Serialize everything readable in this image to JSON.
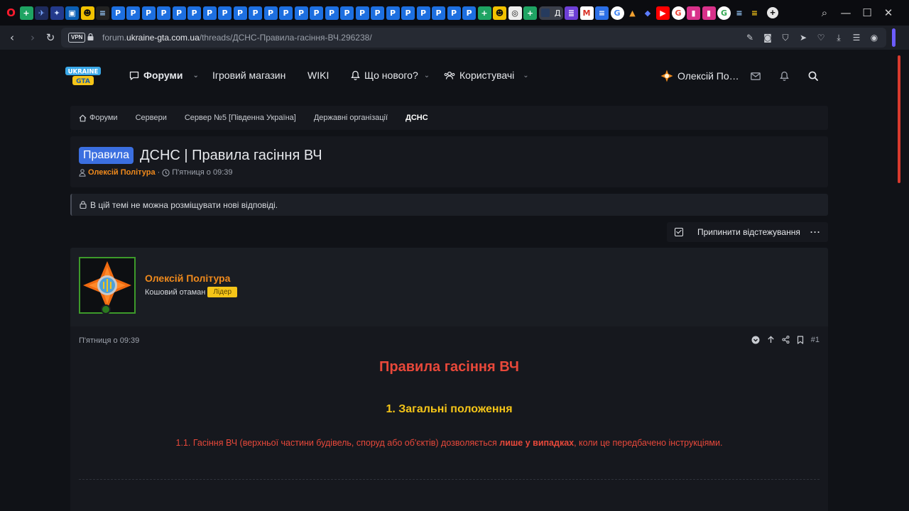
{
  "browser": {
    "active_tab_label": "Д",
    "url_prefix": "forum.",
    "url_host": "ukraine-gta.com.ua",
    "url_path": "/threads/ДСНС-Правила-гасіння-ВЧ.296238/",
    "vpn_label": "VPN",
    "tab_icons": [
      "opera-icon",
      "sheets-icon",
      "bird-icon",
      "ghost-icon",
      "app-icon",
      "radar-icon",
      "gta-icon",
      "p-icon",
      "p-icon",
      "p-icon",
      "p-icon",
      "p-icon",
      "p-icon",
      "p-icon",
      "p-icon",
      "p-icon",
      "p-icon",
      "p-icon",
      "p-icon",
      "p-icon",
      "p-icon",
      "p-icon",
      "p-icon",
      "p-icon",
      "p-icon",
      "p-icon",
      "p-icon",
      "p-icon",
      "p-icon",
      "p-icon",
      "p-icon",
      "sheets-icon",
      "radar-icon",
      "globe-icon",
      "sheets-icon"
    ]
  },
  "site": {
    "nav": {
      "forums": "Форуми",
      "shop": "Ігровий магазин",
      "wiki": "WIKI",
      "whats_new": "Що нового?",
      "users": "Користувачі"
    },
    "account_name": "Олексій По…"
  },
  "breadcrumb": [
    "Форуми",
    "Сервери",
    "Сервер №5 [Південна Україна]",
    "Державні організації"
  ],
  "breadcrumb_current": "ДСНС",
  "thread": {
    "prefix": "Правила",
    "title": "ДСНС | Правила гасіння ВЧ",
    "author": "Олексій Політура",
    "separator": "·",
    "date": "П'ятниця о 09:39"
  },
  "notice": "В цій темі не можна розміщувати нові відповіді.",
  "unwatch_label": "Припинити відстежування",
  "post": {
    "username": "Олексій Політура",
    "user_title": "Кошовий отаман",
    "badge": "Лідер",
    "date": "П'ятниця о 09:39",
    "number": "#1",
    "heading": "Правила гасіння ВЧ",
    "section_heading": "1. Загальні положення",
    "rule_1_1_before": "1.1. Гасіння ВЧ (верхньої частини будівель, споруд або об'єктів) дозволяється ",
    "rule_1_1_bold": "лише у випадках",
    "rule_1_1_after": ", коли це передбачено інструкціями."
  },
  "colors": {
    "accent_red": "#e8483a",
    "accent_yellow": "#f5c518",
    "accent_orange": "#f08a1c",
    "prefix_blue": "#3b6fe0"
  }
}
